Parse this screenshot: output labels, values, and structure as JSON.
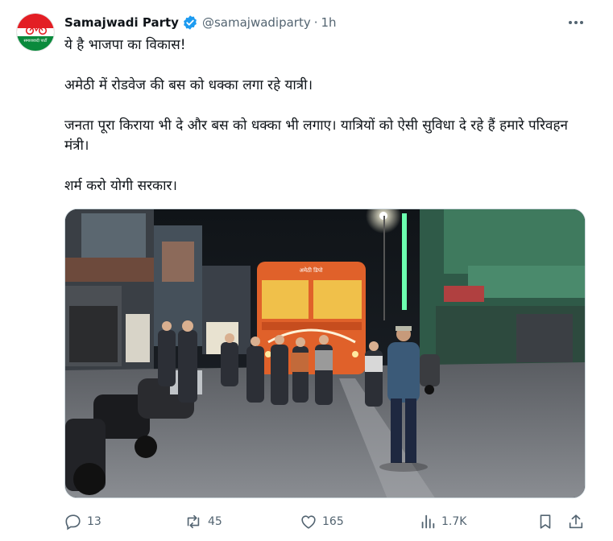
{
  "post": {
    "author_name": "Samajwadi Party",
    "handle": "@samajwadiparty",
    "separator": "·",
    "time": "1h",
    "avatar_caption": "समाजवादी पार्टी",
    "lines": [
      "ये है भाजपा का विकास!",
      "अमेठी में रोडवेज की बस को धक्का लगा रहे यात्री।",
      "जनता पूरा किराया भी दे और बस को धक्का भी लगाए। यात्रियों को ऐसी सुविधा दे रहे हैं हमारे परिवहन मंत्री।",
      "शर्म करो योगी सरकार।"
    ],
    "bus_sign": "अमेठी डिपो"
  },
  "actions": {
    "replies": "13",
    "reposts": "45",
    "likes": "165",
    "views": "1.7K"
  },
  "icons": {
    "verified": "verified-badge-icon",
    "more": "more-options-icon",
    "reply": "reply-icon",
    "repost": "repost-icon",
    "like": "heart-icon",
    "views": "views-icon",
    "bookmark": "bookmark-icon",
    "share": "share-icon"
  },
  "colors": {
    "text": "#0f1419",
    "secondary": "#536471",
    "verified": "#1d9bf0",
    "party_red": "#e31e24",
    "party_green": "#0a8a3c",
    "bus_orange": "#e0612a"
  }
}
